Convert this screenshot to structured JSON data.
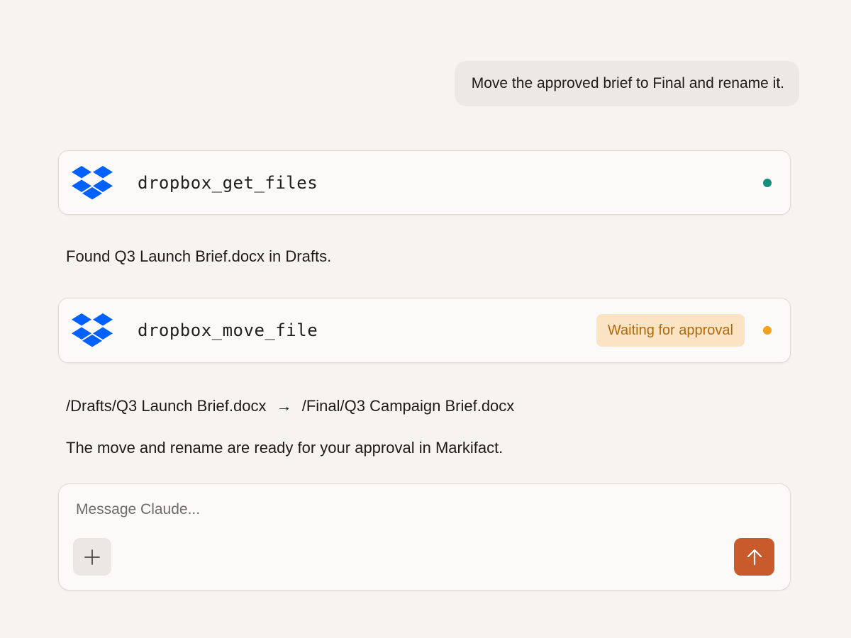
{
  "user_message": {
    "text": "Move the approved brief to Final and rename it."
  },
  "tool_calls": [
    {
      "name": "dropbox_get_files",
      "icon": "dropbox-icon",
      "status": "done",
      "status_color": "#16907c"
    },
    {
      "name": "dropbox_move_file",
      "icon": "dropbox-icon",
      "status": "pending",
      "badge": "Waiting for approval",
      "status_color": "#f0a21b"
    }
  ],
  "assistant_messages": {
    "found": "Found Q3 Launch Brief.docx in Drafts.",
    "move_from": "/Drafts/Q3 Launch Brief.docx",
    "arrow": "→",
    "move_to": "/Final/Q3 Campaign Brief.docx",
    "ready": "The move and rename are ready for your approval in Markifact."
  },
  "composer": {
    "placeholder": "Message Claude...",
    "value": "",
    "add_icon": "plus-icon",
    "send_icon": "arrow-up-icon"
  },
  "colors": {
    "background": "#f7f4f0",
    "dropbox_blue": "#0061fe",
    "send_accent": "#c85a2c",
    "badge_bg": "#fbe3c4",
    "badge_text": "#b06a0c"
  }
}
